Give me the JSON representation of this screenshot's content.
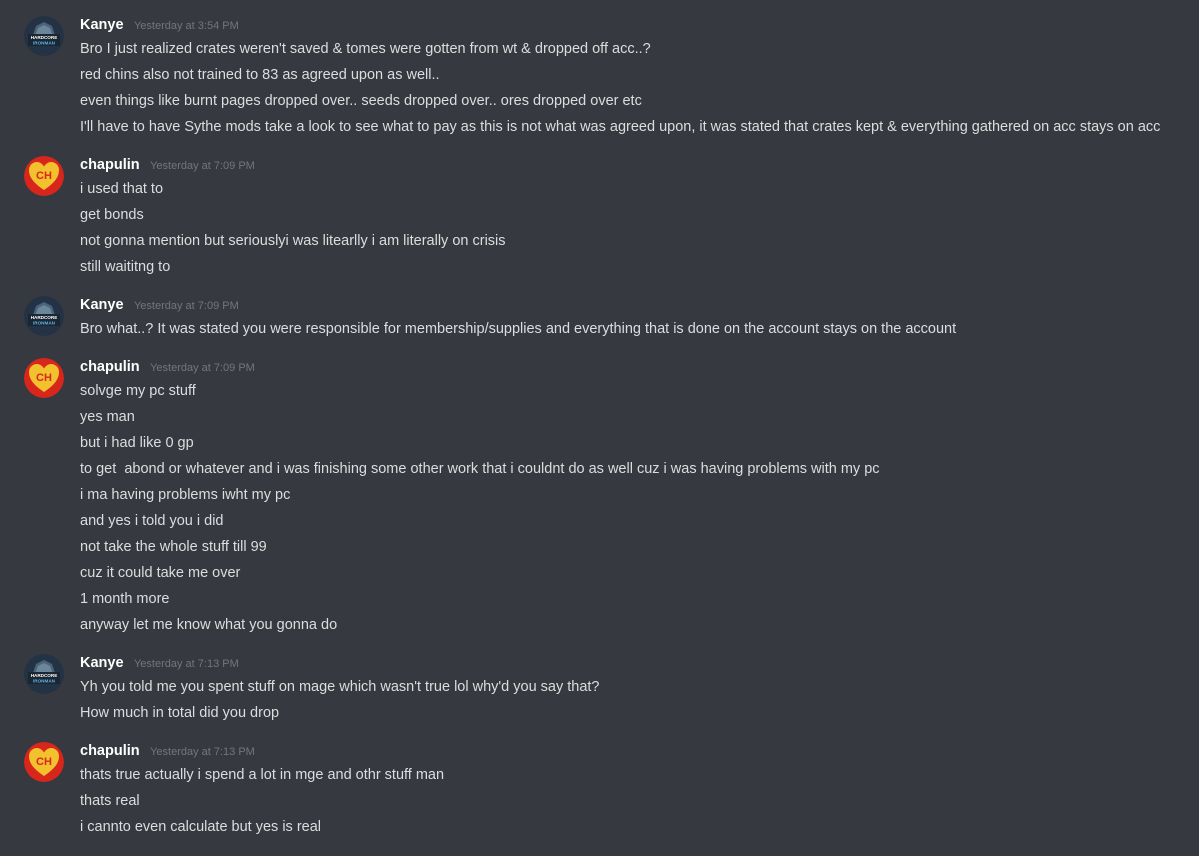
{
  "users": {
    "kanye": {
      "name": "Kanye",
      "avatar_icon": "hardcore-ironman-helmet-icon",
      "avatar_text_top": "HARDCORE",
      "avatar_text_bottom": "IRONMAN"
    },
    "chapulin": {
      "name": "chapulin",
      "avatar_icon": "red-heart-ch-icon",
      "avatar_text": "CH"
    }
  },
  "colors": {
    "background": "#36393f",
    "username": "#ffffff",
    "message_text": "#dcddde",
    "timestamp": "#72767d",
    "heart_yellow": "#f2c12e",
    "heart_red": "#d9261c"
  },
  "messages": [
    {
      "author": "Kanye",
      "timestamp": "Yesterday at 3:54 PM",
      "lines": [
        "Bro I just realized crates weren't saved & tomes were gotten from wt & dropped off acc..?",
        "red chins also not trained to 83 as agreed upon as well..",
        "even things like burnt pages dropped over.. seeds dropped over.. ores dropped over etc",
        "I'll have to have Sythe mods take a look to see what to pay as this is not what was agreed upon, it was stated that crates kept & everything gathered on acc stays on acc"
      ]
    },
    {
      "author": "chapulin",
      "timestamp": "Yesterday at 7:09 PM",
      "lines": [
        "i used that to",
        "get bonds",
        "not gonna mention but seriouslyi was litearlly i am literally on crisis",
        "still waititng to"
      ]
    },
    {
      "author": "Kanye",
      "timestamp": "Yesterday at 7:09 PM",
      "lines": [
        "Bro what..? It was stated you were responsible for membership/supplies and everything that is done on the account stays on the account"
      ]
    },
    {
      "author": "chapulin",
      "timestamp": "Yesterday at 7:09 PM",
      "lines": [
        "solvge my pc stuff",
        "yes man",
        "but i had like 0 gp",
        "to get  abond or whatever and i was finishing some other work that i couldnt do as well cuz i was having problems with my pc",
        "i ma having problems iwht my pc",
        "and yes i told you i did",
        "not take the whole stuff till 99",
        "cuz it could take me over",
        "1 month more",
        "anyway let me know what you gonna do"
      ]
    },
    {
      "author": "Kanye",
      "timestamp": "Yesterday at 7:13 PM",
      "lines": [
        "Yh you told me you spent stuff on mage which wasn't true lol why'd you say that?",
        "How much in total did you drop"
      ]
    },
    {
      "author": "chapulin",
      "timestamp": "Yesterday at 7:13 PM",
      "lines": [
        "thats true actually i spend a lot in mge and othr stuff man",
        "thats real",
        "i cannto even calculate but yes is real"
      ]
    }
  ]
}
